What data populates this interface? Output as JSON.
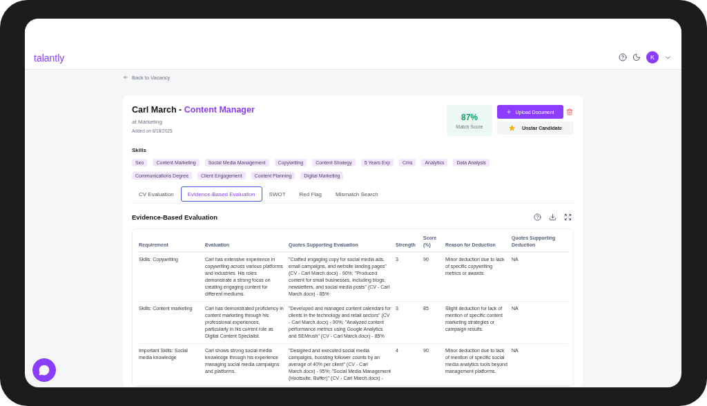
{
  "header": {
    "logo": "talantly",
    "avatar": "K"
  },
  "back_link": "Back to Vacancy",
  "candidate": {
    "name": "Carl March -",
    "role": "Content Manager",
    "department": "at Marketing",
    "added": "Added on 6/18/2025"
  },
  "match": {
    "score": "87%",
    "label": "Match Score"
  },
  "actions": {
    "upload": "Upload Document",
    "unstar": "Unstar Candidate"
  },
  "skills": {
    "title": "Skills",
    "items": [
      "Seo",
      "Content Marketing",
      "Social Media Management",
      "Copywriting",
      "Content Strategy",
      "5 Years Exp",
      "Cms",
      "Analytics",
      "Data Analysis",
      "Communications Degree",
      "Client Engagement",
      "Content Planning",
      "Digital Marketing"
    ]
  },
  "tabs": [
    {
      "label": "CV Evaluation",
      "selected": false
    },
    {
      "label": "Evidence-Based Evaluation",
      "selected": true
    },
    {
      "label": "SWOT",
      "selected": false
    },
    {
      "label": "Red Flag",
      "selected": false
    },
    {
      "label": "Mismatch Search",
      "selected": false
    }
  ],
  "section_title": "Evidence-Based Evaluation",
  "table": {
    "columns": [
      "Requirement",
      "Evaluation",
      "Quotes Supporting Evaluation",
      "Strength",
      "Score (%)",
      "Reason for Deduction",
      "Quotes Supporting Deduction"
    ],
    "rows": [
      [
        "Skills: Copywriting",
        "Carl has extensive experience in copywriting across various platforms and industries. His roles demonstrate a strong focus on creating engaging content for different mediums.",
        "\"Crafted engaging copy for social media ads, email campaigns, and website landing pages\" (CV - Carl March.docx) - 90%; \"Produced content for small businesses, including blogs, newsletters, and social media posts\" (CV - Carl March.docx) - 85%",
        "3",
        "90",
        "Minor deduction due to lack of specific copywriting metrics or awards.",
        "NA"
      ],
      [
        "Skills: Content marketing",
        "Carl has demonstrated proficiency in content marketing through his professional experiences, particularly in his current role as Digital Content Specialist.",
        "\"Developed and managed content calendars for clients in the technology and retail sectors\" (CV - Carl March.docx) - 90%; \"Analyzed content performance metrics using Google Analytics and SEMrush\" (CV - Carl March.docx) - 85%",
        "3",
        "85",
        "Slight deduction for lack of mention of specific content marketing strategies or campaign results.",
        "NA"
      ],
      [
        "Important Skills: Social media knowledge",
        "Carl shows strong social media knowledge through his experience managing social media campaigns and platforms.",
        "\"Designed and executed social media campaigns, boosting follower counts by an average of 40% per client\" (CV - Carl March.docx) - 95%; \"Social Media Management (Hootsuite, Buffer)\" (CV - Carl March.docx) -",
        "4",
        "90",
        "Minor deduction due to lack of mention of specific social media analytics tools beyond management platforms.",
        "NA"
      ]
    ]
  }
}
